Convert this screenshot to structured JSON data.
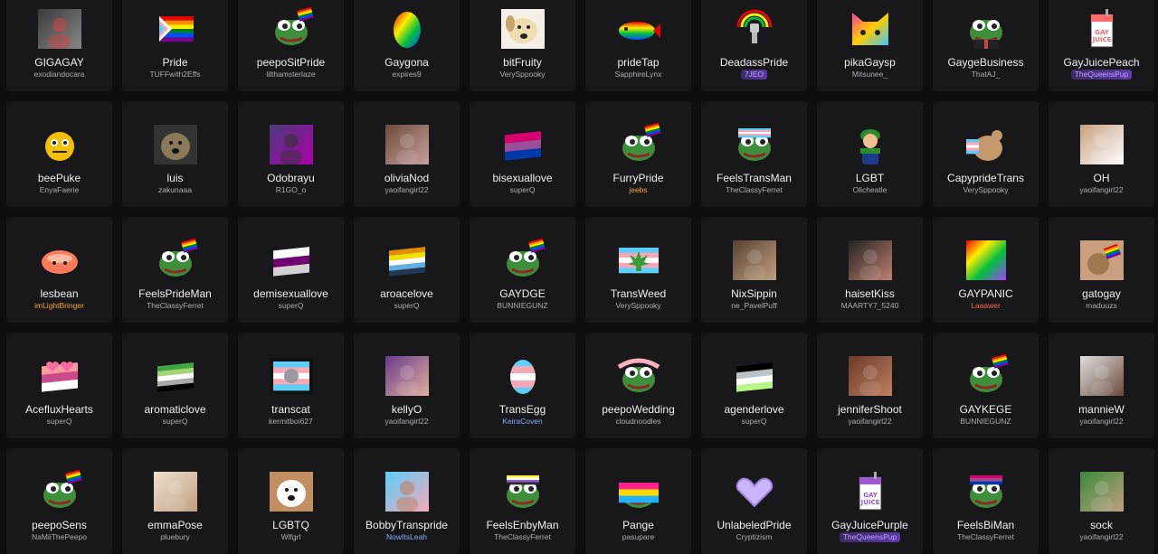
{
  "emotes": [
    {
      "name": "GIGAGAY",
      "owner": "exodiandocara",
      "icon": "photo-icon",
      "palette": [
        "#3a3a3a",
        "#888",
        "#c44"
      ]
    },
    {
      "name": "Pride",
      "owner": "TUFFwith2Effs",
      "icon": "pride-flag-icon",
      "palette": [
        "#e40303",
        "#ff8c00",
        "#ffed00",
        "#008026",
        "#004dff",
        "#750787"
      ]
    },
    {
      "name": "peepoSitPride",
      "owner": "lilthamsterlaze",
      "icon": "pepe-flag-icon",
      "palette": [
        "#3e8f3a",
        "#2a5bd7",
        "#e40303"
      ]
    },
    {
      "name": "Gaygona",
      "owner": "expires9",
      "icon": "rainbow-head-icon",
      "palette": [
        "#e40303",
        "#ffed00",
        "#008026",
        "#004dff"
      ]
    },
    {
      "name": "bitFruity",
      "owner": "VerySppooky",
      "icon": "dog-icon",
      "palette": [
        "#f0dcb0",
        "#c8a66a"
      ]
    },
    {
      "name": "prideTap",
      "owner": "SapphireLynx",
      "icon": "rainbow-fish-icon",
      "palette": [
        "#e40303",
        "#ffed00",
        "#008026",
        "#004dff"
      ]
    },
    {
      "name": "DeadassPride",
      "owner": "7JEO",
      "ownerStyle": "grad",
      "icon": "rainbow-robot-icon",
      "palette": [
        "#e40303",
        "#ffed00",
        "#004dff",
        "#bbbbbb"
      ]
    },
    {
      "name": "pikaGaysp",
      "owner": "Mitsunee_",
      "icon": "rainbow-cat-icon",
      "palette": [
        "#ff3ea5",
        "#ffcc00",
        "#3ec7ff"
      ]
    },
    {
      "name": "GaygeBusiness",
      "owner": "ThatAJ_",
      "icon": "pepe-suit-icon",
      "palette": [
        "#3e8f3a",
        "#222",
        "#c44"
      ]
    },
    {
      "name": "GayJuicePeach",
      "owner": "TheQueensPup",
      "ownerStyle": "grad",
      "icon": "juice-box-icon",
      "palette": [
        "#fff",
        "#ff6a6a"
      ]
    },
    {
      "name": "beePuke",
      "owner": "EnyaFaerie",
      "icon": "bee-icon",
      "palette": [
        "#f5c000",
        "#222"
      ]
    },
    {
      "name": "luis",
      "owner": "zakunaaa",
      "icon": "dog-photo-icon",
      "palette": [
        "#8a7a5a",
        "#333"
      ]
    },
    {
      "name": "Odobrayu",
      "owner": "R1GO_o",
      "icon": "photo-icon",
      "palette": [
        "#4b3b7a",
        "#a0a",
        "#333"
      ]
    },
    {
      "name": "oliviaNod",
      "owner": "yaoifangirl22",
      "icon": "photo-icon",
      "palette": [
        "#6b4b3b",
        "#c8a0a0"
      ]
    },
    {
      "name": "bisexuallove",
      "owner": "superQ",
      "icon": "bi-flag-icon",
      "palette": [
        "#d60270",
        "#9b4f96",
        "#0038a8"
      ]
    },
    {
      "name": "FurryPride",
      "owner": "jeebs",
      "ownerStyle": "gold",
      "icon": "pepe-flag-icon",
      "palette": [
        "#3e8f3a",
        "#ffd6f0"
      ]
    },
    {
      "name": "FeelsTransMan",
      "owner": "TheClassyFerret",
      "icon": "trans-pepe-icon",
      "palette": [
        "#5bcefa",
        "#f5a9b8",
        "#fff"
      ]
    },
    {
      "name": "LGBT",
      "owner": "Olicheatle",
      "icon": "luigi-icon",
      "palette": [
        "#2e8b2e",
        "#1e3a8a"
      ]
    },
    {
      "name": "CapyprideTrans",
      "owner": "VerySppooky",
      "icon": "capybara-icon",
      "palette": [
        "#c49a6c",
        "#5bcefa",
        "#f5a9b8"
      ]
    },
    {
      "name": "OH",
      "owner": "yaoifangirl22",
      "icon": "photo-icon",
      "palette": [
        "#c8a080",
        "#fff"
      ]
    },
    {
      "name": "lesbean",
      "owner": "imLightBringer",
      "ownerStyle": "gold",
      "icon": "bean-icon",
      "palette": [
        "#ff7a5a",
        "#ffbca0"
      ]
    },
    {
      "name": "FeelsPrideMan",
      "owner": "TheClassyFerret",
      "icon": "pride-pepe-icon",
      "palette": [
        "#3e8f3a",
        "#e40303",
        "#004dff"
      ]
    },
    {
      "name": "demisexuallove",
      "owner": "superQ",
      "icon": "demi-flag-icon",
      "palette": [
        "#fff",
        "#6e0070",
        "#d2d2d2"
      ]
    },
    {
      "name": "aroacelove",
      "owner": "superQ",
      "icon": "aroace-flag-icon",
      "palette": [
        "#e28c00",
        "#ece100",
        "#fff",
        "#62aedc",
        "#203856"
      ]
    },
    {
      "name": "GAYDGE",
      "owner": "BUNNIEGUNZ",
      "icon": "pepe-rainbow-icon",
      "palette": [
        "#3e8f3a",
        "#e40303",
        "#8b2a5a"
      ]
    },
    {
      "name": "TransWeed",
      "owner": "VerySppooky",
      "icon": "trans-leaf-icon",
      "palette": [
        "#5bcefa",
        "#f5a9b8",
        "#3a9a3a"
      ]
    },
    {
      "name": "NixSippin",
      "owner": "ne_PavelPuff",
      "icon": "photo-icon",
      "palette": [
        "#5a4030",
        "#c0a080"
      ]
    },
    {
      "name": "haisetKiss",
      "owner": "MAARTY7_5240",
      "icon": "photo-icon",
      "palette": [
        "#222",
        "#c08070"
      ]
    },
    {
      "name": "GAYPANIC",
      "owner": "Laaawer",
      "ownerStyle": "red",
      "icon": "rainbow-square-icon",
      "palette": [
        "#e40303",
        "#ffed00",
        "#008026",
        "#004dff"
      ]
    },
    {
      "name": "gatogay",
      "owner": "maduuzs",
      "icon": "cat-flag-icon",
      "palette": [
        "#c8a080",
        "#e40303"
      ]
    },
    {
      "name": "AcefluxHearts",
      "owner": "superQ",
      "icon": "heart-flag-icon",
      "palette": [
        "#ff9aa2",
        "#c94b8a",
        "#fff"
      ]
    },
    {
      "name": "aromaticlove",
      "owner": "superQ",
      "icon": "aro-flag-icon",
      "palette": [
        "#3da542",
        "#a7d379",
        "#fff",
        "#a9a9a9",
        "#000"
      ]
    },
    {
      "name": "transcat",
      "owner": "kermitboi627",
      "icon": "trans-cat-icon",
      "palette": [
        "#5bcefa",
        "#f5a9b8",
        "#fff"
      ]
    },
    {
      "name": "kellyO",
      "owner": "yaoifangirl22",
      "icon": "photo-icon",
      "palette": [
        "#6a3a8a",
        "#e0b0a0"
      ]
    },
    {
      "name": "TransEgg",
      "owner": "KeiraCoven",
      "ownerStyle": "blue",
      "icon": "trans-egg-icon",
      "palette": [
        "#5bcefa",
        "#f5a9b8",
        "#fff"
      ]
    },
    {
      "name": "peepoWedding",
      "owner": "cloudnoodles",
      "icon": "pepe-wedding-icon",
      "palette": [
        "#3e8f3a",
        "#fff",
        "#ffb0c0"
      ]
    },
    {
      "name": "agenderlove",
      "owner": "superQ",
      "icon": "agender-flag-icon",
      "palette": [
        "#000",
        "#bcc4c7",
        "#fff",
        "#b7f684"
      ]
    },
    {
      "name": "jenniferShoot",
      "owner": "yaoifangirl22",
      "icon": "photo-icon",
      "palette": [
        "#6a3a2a",
        "#c08060"
      ]
    },
    {
      "name": "GAYKEGE",
      "owner": "BUNNIEGUNZ",
      "icon": "pepe-rainbow-icon",
      "palette": [
        "#3e8f3a",
        "#e40303",
        "#ffed00"
      ]
    },
    {
      "name": "mannieW",
      "owner": "yaoifangirl22",
      "icon": "photo-icon",
      "palette": [
        "#e0e0e0",
        "#6a4a3a"
      ]
    },
    {
      "name": "peepoSens",
      "owner": "NaMiiThePeepo",
      "icon": "pepe-flag-icon",
      "palette": [
        "#3e8f3a",
        "#e40303",
        "#004dff"
      ]
    },
    {
      "name": "emmaPose",
      "owner": "pluebury",
      "icon": "photo-icon",
      "palette": [
        "#f0e0d0",
        "#c0a080"
      ]
    },
    {
      "name": "LGBTQ",
      "owner": "Wlfgrl",
      "icon": "dog-photo-icon",
      "palette": [
        "#fff",
        "#c09060"
      ]
    },
    {
      "name": "BobbyTranspride",
      "owner": "NowItsLeah",
      "ownerStyle": "blue",
      "icon": "photo-icon",
      "palette": [
        "#5bcefa",
        "#f5a9b8",
        "#c08060"
      ]
    },
    {
      "name": "FeelsEnbyMan",
      "owner": "TheClassyFerret",
      "icon": "enby-pepe-icon",
      "palette": [
        "#fcf434",
        "#fff",
        "#9c59d1",
        "#2c2c2c"
      ]
    },
    {
      "name": "Pange",
      "owner": "pasupare",
      "icon": "pan-pepe-icon",
      "palette": [
        "#ff218c",
        "#ffd800",
        "#21b1ff"
      ]
    },
    {
      "name": "UnlabeledPride",
      "owner": "Cryptizism",
      "icon": "heart-hands-icon",
      "palette": [
        "#c9b6ff",
        "#9c7fe0"
      ]
    },
    {
      "name": "GayJuicePurple",
      "owner": "TheQueensPup",
      "ownerStyle": "grad",
      "icon": "juice-box-icon",
      "palette": [
        "#fff",
        "#9b59d0"
      ]
    },
    {
      "name": "FeelsBiMan",
      "owner": "TheClassyFerret",
      "icon": "bi-pepe-icon",
      "palette": [
        "#d60270",
        "#9b4f96",
        "#0038a8"
      ]
    },
    {
      "name": "sock",
      "owner": "yaoifangirl22",
      "icon": "photo-icon",
      "palette": [
        "#3a8a3a",
        "#c0a080"
      ]
    }
  ]
}
